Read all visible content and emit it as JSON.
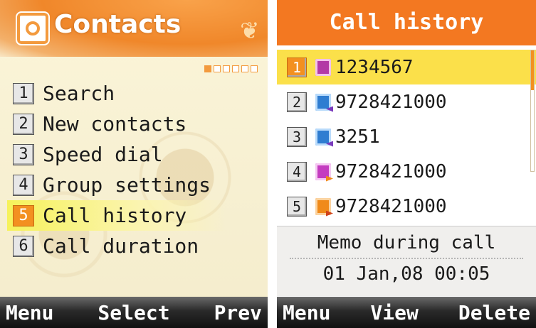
{
  "left": {
    "title": "Contacts",
    "pager": {
      "count": 6,
      "active_index": 0
    },
    "menu": [
      {
        "num": "1",
        "label": "Search"
      },
      {
        "num": "2",
        "label": "New contacts"
      },
      {
        "num": "3",
        "label": "Speed dial"
      },
      {
        "num": "4",
        "label": "Group settings"
      },
      {
        "num": "5",
        "label": "Call history",
        "selected": true
      },
      {
        "num": "6",
        "label": "Call duration"
      }
    ],
    "softkeys": {
      "left": "Menu",
      "center": "Select",
      "right": "Prev"
    }
  },
  "right": {
    "title": "Call history",
    "calls": [
      {
        "num": "1",
        "icon": "dialed-call-icon",
        "number": "1234567",
        "selected": true
      },
      {
        "num": "2",
        "icon": "received-call-icon",
        "number": "9728421000"
      },
      {
        "num": "3",
        "icon": "received-call-icon",
        "number": "3251"
      },
      {
        "num": "4",
        "icon": "missed-call-icon",
        "number": "9728421000"
      },
      {
        "num": "5",
        "icon": "outgoing-call-icon",
        "number": "9728421000"
      }
    ],
    "memo": {
      "label": "Memo during call",
      "timestamp": "01 Jan,08 00:05"
    },
    "softkeys": {
      "left": "Menu",
      "center": "View",
      "right": "Delete"
    }
  },
  "colors": {
    "accent_orange": "#f37821",
    "highlight_yellow": "#fbe04a",
    "softkey_bar": "#1a1a1a"
  }
}
